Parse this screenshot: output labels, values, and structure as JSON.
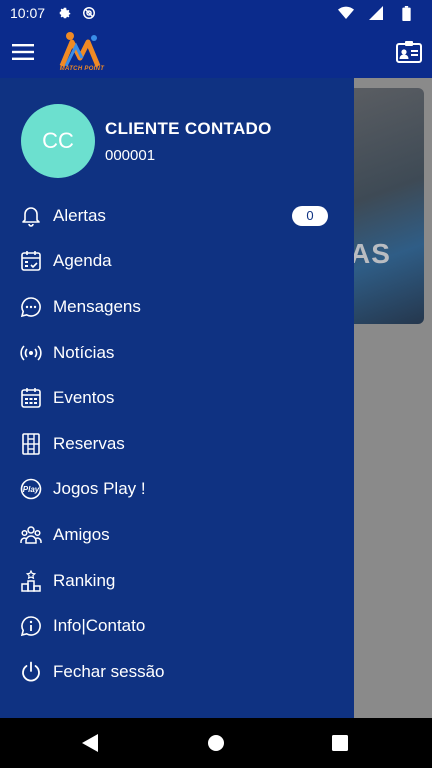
{
  "status_bar": {
    "time": "10:07",
    "icons_left": [
      "gear-icon",
      "at-sign-icon"
    ],
    "icons_right": [
      "wifi-icon",
      "signal-icon",
      "battery-icon"
    ]
  },
  "app_bar": {
    "logo_text": "MATCH POINT",
    "icons": [
      "hamburger-menu-icon",
      "contact-card-icon"
    ]
  },
  "background": {
    "card_text": "AS"
  },
  "profile": {
    "initials": "CC",
    "name": "CLIENTE CONTADO",
    "code": "000001"
  },
  "menu": {
    "items": [
      {
        "label": "Alertas",
        "icon": "bell-icon",
        "badge": "0"
      },
      {
        "label": "Agenda",
        "icon": "calendar-check-icon"
      },
      {
        "label": "Mensagens",
        "icon": "chat-bubble-icon"
      },
      {
        "label": "Notícias",
        "icon": "broadcast-icon"
      },
      {
        "label": "Eventos",
        "icon": "calendar-grid-icon"
      },
      {
        "label": "Reservas",
        "icon": "court-icon"
      },
      {
        "label": "Jogos Play !",
        "icon": "play-badge-icon"
      },
      {
        "label": "Amigos",
        "icon": "group-icon"
      },
      {
        "label": "Ranking",
        "icon": "podium-icon"
      },
      {
        "label": "Info|Contato",
        "icon": "info-icon"
      },
      {
        "label": "Fechar sessão",
        "icon": "power-icon"
      }
    ]
  },
  "nav_bar": {
    "icons": [
      "back-triangle-icon",
      "home-circle-icon",
      "recents-square-icon"
    ]
  },
  "colors": {
    "primary": "#0b2b8c",
    "drawer": "#0f3282",
    "avatar": "#6ce0cf",
    "logo_orange": "#f08a24"
  }
}
